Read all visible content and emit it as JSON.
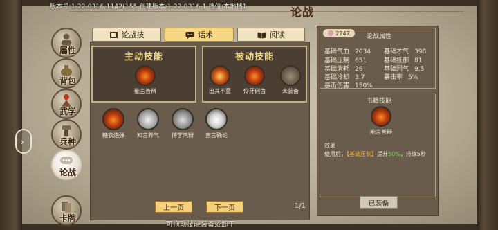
{
  "version_text": "版本号:1.22.0316.1142(155   创建版本:1.22.0316.1  档位:本地档1",
  "title": "论战",
  "close_label": "✕",
  "nav": [
    {
      "label": "屬性",
      "icon": "person-icon",
      "active": false
    },
    {
      "label": "背包",
      "icon": "bag-icon",
      "active": false
    },
    {
      "label": "武学",
      "icon": "martial-arts-icon",
      "active": false
    },
    {
      "label": "兵种",
      "icon": "soldier-icon",
      "active": false
    },
    {
      "label": "论战",
      "icon": "chat-bubble-icon",
      "active": true
    },
    {
      "label": "卡牌",
      "icon": "card-icon",
      "active": false
    }
  ],
  "tabs": [
    {
      "label": "论战技",
      "icon": "book-icon",
      "active": false
    },
    {
      "label": "话术",
      "icon": "speech-icon",
      "active": true
    },
    {
      "label": "阅读",
      "icon": "open-book-icon",
      "active": false
    }
  ],
  "active_skills": {
    "title": "主动技能",
    "items": [
      {
        "name": "能言善辩",
        "icon": "fire-fist-icon"
      }
    ]
  },
  "passive_skills": {
    "title": "被动技能",
    "items": [
      {
        "name": "出其不意",
        "icon": "ember-icon"
      },
      {
        "name": "伶牙俐齿",
        "icon": "fire-mouth-icon"
      },
      {
        "name": "未装备",
        "icon": "empty-slot-icon"
      }
    ]
  },
  "skill_list": [
    {
      "name": "糖衣炮弹",
      "icon": "fire-swirl-icon"
    },
    {
      "name": "知言养气",
      "icon": "silver-orb-icon"
    },
    {
      "name": "博学鸿辩",
      "icon": "gear-orb-icon"
    },
    {
      "name": "直言确论",
      "icon": "mouth-orb-icon"
    }
  ],
  "pager": {
    "prev": "上一页",
    "next": "下一页",
    "page": "1/1"
  },
  "hint": "可拖动技能装备或卸下",
  "attributes": {
    "level": "2247",
    "title": "论战属性",
    "rows": [
      {
        "k1": "基础气血",
        "v1": "2034",
        "k2": "基础才气",
        "v2": "398"
      },
      {
        "k1": "基础压制",
        "v1": "651",
        "k2": "基础抵御",
        "v2": "81"
      },
      {
        "k1": "基础消耗",
        "v1": "26",
        "k2": "基础回气",
        "v2": "9.5"
      },
      {
        "k1": "基础冷却",
        "v1": "3.7",
        "k2": "暴击率",
        "v2": "5%"
      },
      {
        "k1": "暴击伤害",
        "v1": "150%",
        "k2": "",
        "v2": ""
      }
    ]
  },
  "book_skill": {
    "title": "书籍技能",
    "name": "能言善辩",
    "effect_label": "效果",
    "effect_prefix": "使用后，",
    "effect_highlight": "【基础压制】",
    "effect_mid": "提升",
    "effect_value": "50%",
    "effect_suffix": "，持续5秒",
    "button": "已装备"
  }
}
